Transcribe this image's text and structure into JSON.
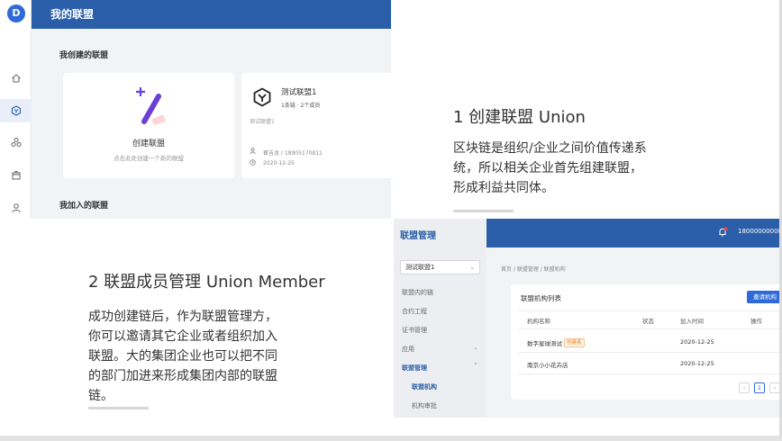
{
  "screen1": {
    "header_title": "我的联盟",
    "section_created": "我创建的联盟",
    "section_joined": "我加入的联盟",
    "create_card": {
      "title": "创建联盟",
      "subtitle": "点击此处创建一个新的联盟"
    },
    "union_card": {
      "name": "测试联盟1",
      "stats": "1条链 · 2个成员",
      "description": "测试联盟1",
      "creator": "崔吉龙 / 18905170811",
      "date": "2020-12-25"
    },
    "sidebar_icons": [
      "home-icon",
      "union-icon",
      "cluster-icon",
      "box-icon",
      "user-icon"
    ]
  },
  "section1": {
    "title": "1 创建联盟 Union",
    "lines": [
      "区块链是组织/企业之间价值传递系",
      "统，所以相关企业首先组建联盟，",
      "形成利益共同体。"
    ]
  },
  "section2": {
    "title": "2 联盟成员管理 Union Member",
    "lines": [
      "成功创建链后，作为联盟管理方，",
      "你可以邀请其它企业或者组织加入",
      "联盟。大的集团企业也可以把不同",
      "的部门加进来形成集团内部的联盟",
      "链。"
    ]
  },
  "screen2": {
    "brand": "联盟管理",
    "user": "18000000000",
    "notification_icon": "bell-icon",
    "selected_union": "测试联盟1",
    "menu": [
      "联盟内的链",
      "合约工程",
      "证书管理",
      "应用",
      "联盟管理"
    ],
    "submenu": [
      "联盟机构",
      "机构审批"
    ],
    "breadcrumb": "首页 / 联盟管理 / 联盟机构",
    "panel_title": "联盟机构列表",
    "invite_button": "邀请机构",
    "columns": [
      "机构名称",
      "状态",
      "加入时间",
      "操作"
    ],
    "rows": [
      {
        "name": "数字星球测试",
        "badge": "创建者",
        "date": "2020-12-25"
      },
      {
        "name": "南京小小花卉店",
        "badge": "",
        "date": "2020-12-25"
      }
    ],
    "pagination": {
      "prev": "‹",
      "current": "1",
      "next": "›"
    }
  },
  "colors": {
    "brand_blue": "#2a5ea8",
    "accent_blue": "#2f6bd8",
    "create_purple": "#6b3fd6",
    "badge_orange": "#e6862f"
  }
}
